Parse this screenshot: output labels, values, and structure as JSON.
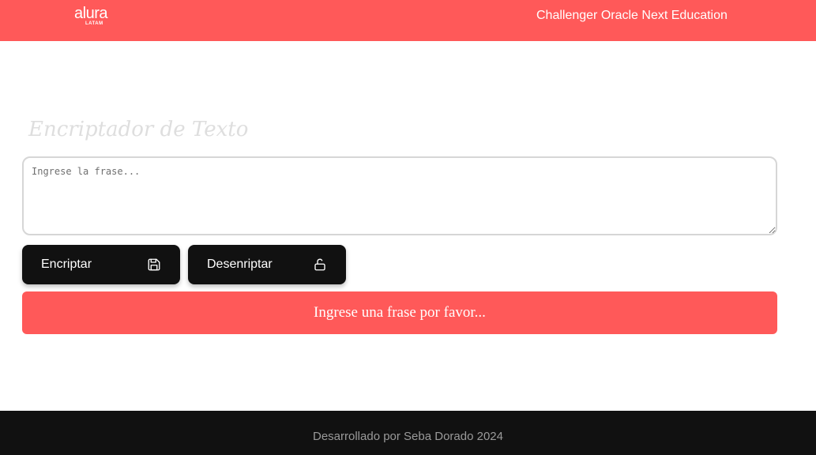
{
  "header": {
    "logo": {
      "word": "alura",
      "sub": "LATAM"
    },
    "title": "Challenger Oracle Next Education"
  },
  "main": {
    "title": "Encriptador de Texto",
    "input": {
      "value": "",
      "placeholder": "Ingrese la frase..."
    },
    "buttons": {
      "encrypt": {
        "label": "Encriptar",
        "icon": "save-icon"
      },
      "decrypt": {
        "label": "Desenriptar",
        "icon": "unlock-icon"
      }
    },
    "result": {
      "text": "Ingrese una frase por favor..."
    }
  },
  "footer": {
    "text": "Desarrollado por Seba Dorado 2024"
  },
  "colors": {
    "accent": "#ff5959",
    "button": "#111111",
    "footer": "#111111"
  }
}
